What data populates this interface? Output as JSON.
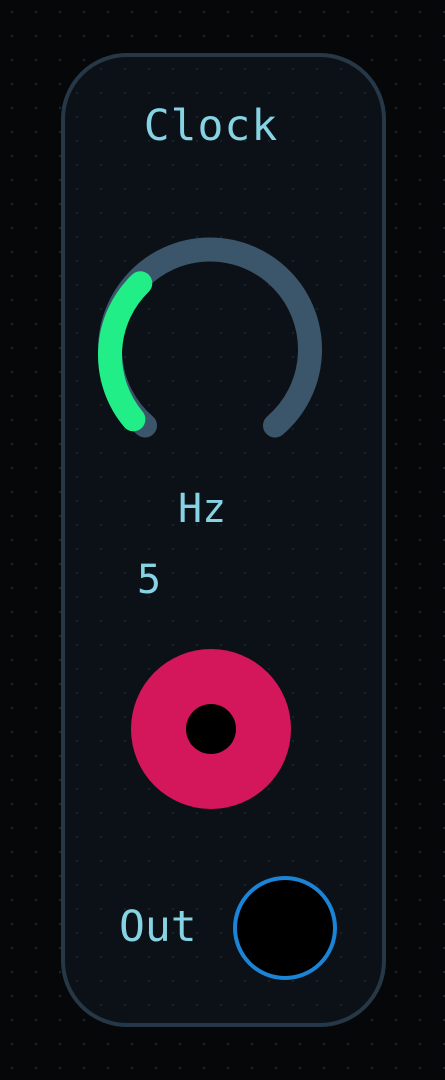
{
  "module": {
    "title": "Clock",
    "knob": {
      "unit": "Hz",
      "value": "5",
      "level": 0.33,
      "colors": {
        "active": "#22ee88",
        "track": "#3b566a"
      }
    },
    "trigger": {
      "icon": "trigger-pad",
      "color": "#d4165a"
    },
    "output": {
      "label": "Out",
      "jack_color": "#1b84d6"
    }
  }
}
